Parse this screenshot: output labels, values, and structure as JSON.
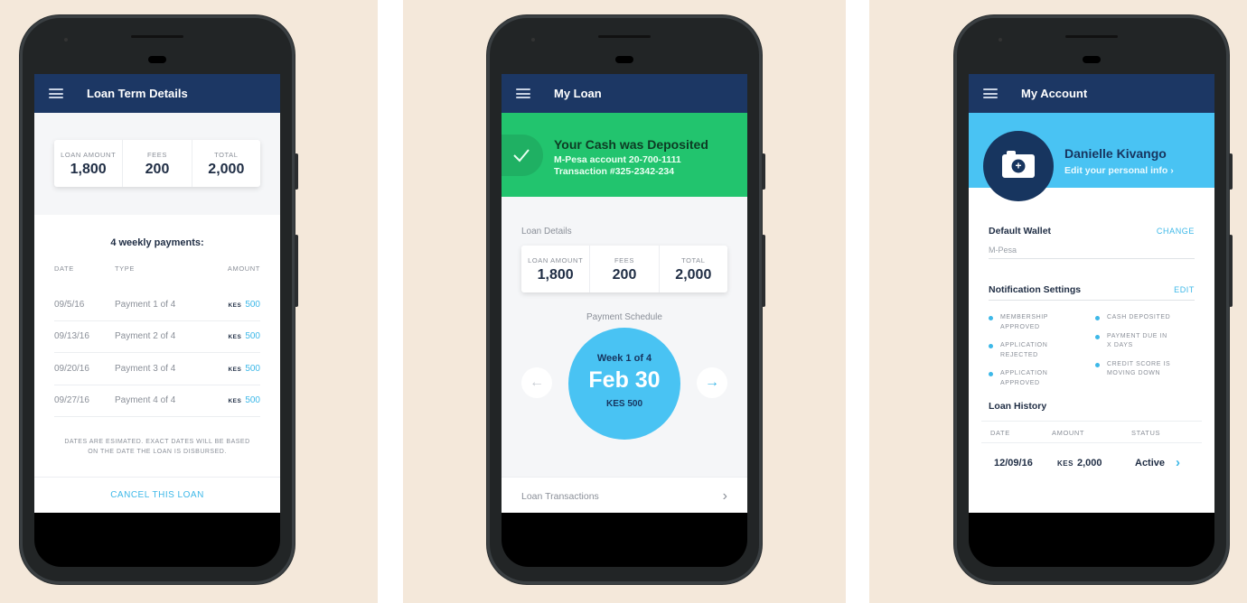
{
  "screens": {
    "loan_term": {
      "title": "Loan Term Details",
      "stats": [
        {
          "label": "LOAN AMOUNT",
          "value": "1,800"
        },
        {
          "label": "FEES",
          "value": "200"
        },
        {
          "label": "TOTAL",
          "value": "2,000"
        }
      ],
      "section_title": "4 weekly payments:",
      "columns": [
        "DATE",
        "TYPE",
        "AMOUNT"
      ],
      "rows": [
        {
          "date": "09/5/16",
          "type": "Payment 1 of 4",
          "currency": "KES",
          "amount": "500"
        },
        {
          "date": "09/13/16",
          "type": "Payment 2 of 4",
          "currency": "KES",
          "amount": "500"
        },
        {
          "date": "09/20/16",
          "type": "Payment 3 of 4",
          "currency": "KES",
          "amount": "500"
        },
        {
          "date": "09/27/16",
          "type": "Payment 4 of 4",
          "currency": "KES",
          "amount": "500"
        }
      ],
      "note": "DATES ARE ESIMATED. EXACT DATES WILL BE BASED ON THE DATE THE LOAN IS DISBURSED.",
      "cancel_label": "CANCEL THIS LOAN"
    },
    "my_loan": {
      "title": "My Loan",
      "banner": {
        "title": "Your Cash was Deposited",
        "line1": "M-Pesa account 20-700-1111",
        "line2": "Transaction #325-2342-234",
        "icon": "check-icon"
      },
      "details_label": "Loan Details",
      "stats": [
        {
          "label": "LOAN AMOUNT",
          "value": "1,800"
        },
        {
          "label": "FEES",
          "value": "200"
        },
        {
          "label": "TOTAL",
          "value": "2,000"
        }
      ],
      "schedule_label": "Payment Schedule",
      "schedule": {
        "week": "Week 1 of 4",
        "date": "Feb 30",
        "amount": "KES 500"
      },
      "prev_icon": "←",
      "next_icon": "→",
      "transactions_label": "Loan Transactions",
      "chevron": "›"
    },
    "my_account": {
      "title": "My Account",
      "name": "Danielle Kivango",
      "edit_label": "Edit your personal info ›",
      "wallet_label": "Default Wallet",
      "wallet_action": "CHANGE",
      "wallet_value": "M-Pesa",
      "notif_label": "Notification Settings",
      "notif_action": "EDIT",
      "notif_left": [
        "MEMBERSHIP APPROVED",
        "APPLICATION REJECTED",
        "APPLICATION APPROVED"
      ],
      "notif_right": [
        "CASH DEPOSITED",
        "PAYMENT DUE IN X DAYS",
        "CREDIT SCORE IS MOVING DOWN"
      ],
      "history_label": "Loan History",
      "history_columns": [
        "DATE",
        "AMOUNT",
        "STATUS"
      ],
      "history_rows": [
        {
          "date": "12/09/16",
          "currency": "KES",
          "amount": "2,000",
          "status": "Active"
        }
      ],
      "chevron": "›"
    }
  },
  "colors": {
    "background": "#f4e8da",
    "appbar": "#1c3764",
    "accent": "#3db8e8",
    "success": "#22c46e",
    "profile": "#49c3f3"
  }
}
